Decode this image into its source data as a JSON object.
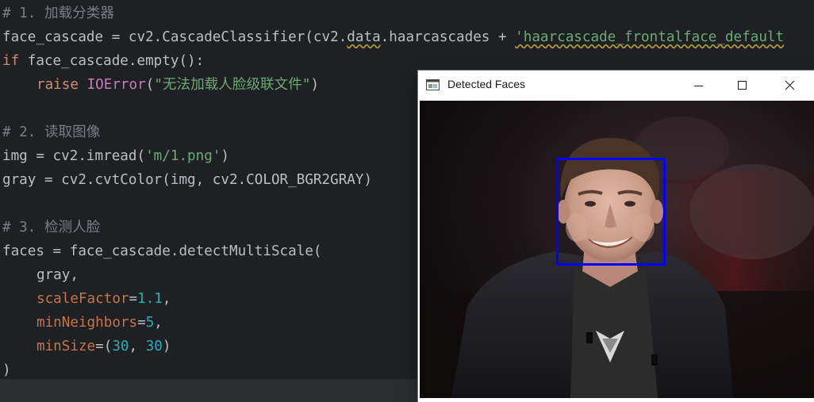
{
  "code": {
    "lines": [
      {
        "id": "l1",
        "comment": "# 1. 加载分类器"
      },
      {
        "id": "l2",
        "v1": "face_cascade = cv2.CascadeClassifier(cv2.",
        "v2": "data",
        "v3": ".haarcascades + ",
        "str": "'haarcascade_frontalface_default"
      },
      {
        "id": "l3",
        "kw": "if",
        "rest": " face_cascade.empty():"
      },
      {
        "id": "l4",
        "kw": "raise",
        "sp": " ",
        "cls": "IOError",
        "p1": "(",
        "str": "\"无法加载人脸级联文件\"",
        "p2": ")"
      },
      {
        "id": "l5"
      },
      {
        "id": "l6",
        "comment": "# 2. 读取图像"
      },
      {
        "id": "l7",
        "a": "img = cv2.imread(",
        "str": "'m/1.png'",
        "b": ")"
      },
      {
        "id": "l8",
        "text": "gray = cv2.cvtColor(img, cv2.COLOR_BGR2GRAY)"
      },
      {
        "id": "l9"
      },
      {
        "id": "l10",
        "comment": "# 3. 检测人脸"
      },
      {
        "id": "l11",
        "text": "faces = face_cascade.detectMultiScale("
      },
      {
        "id": "l12",
        "text": "gray,"
      },
      {
        "id": "l13",
        "param": "scaleFactor",
        "eq": "=",
        "num": "1.1",
        "tail": ","
      },
      {
        "id": "l14",
        "param": "minNeighbors",
        "eq": "=",
        "num": "5",
        "tail": ","
      },
      {
        "id": "l15",
        "param": "minSize",
        "eq": "=(",
        "num1": "30",
        "mid": ", ",
        "num2": "30",
        "tail": ")"
      },
      {
        "id": "l16",
        "text": ")"
      }
    ]
  },
  "window": {
    "title": "Detected Faces",
    "controls": {
      "minimize": "minimize-icon",
      "maximize": "maximize-icon",
      "close": "close-icon"
    },
    "detection_box_color": "#0000ff"
  },
  "colors": {
    "editor_bg": "#1f2023",
    "keyword": "#cf8e6d",
    "string": "#6aab73",
    "number": "#2aacb8",
    "comment": "#7a7e85"
  }
}
